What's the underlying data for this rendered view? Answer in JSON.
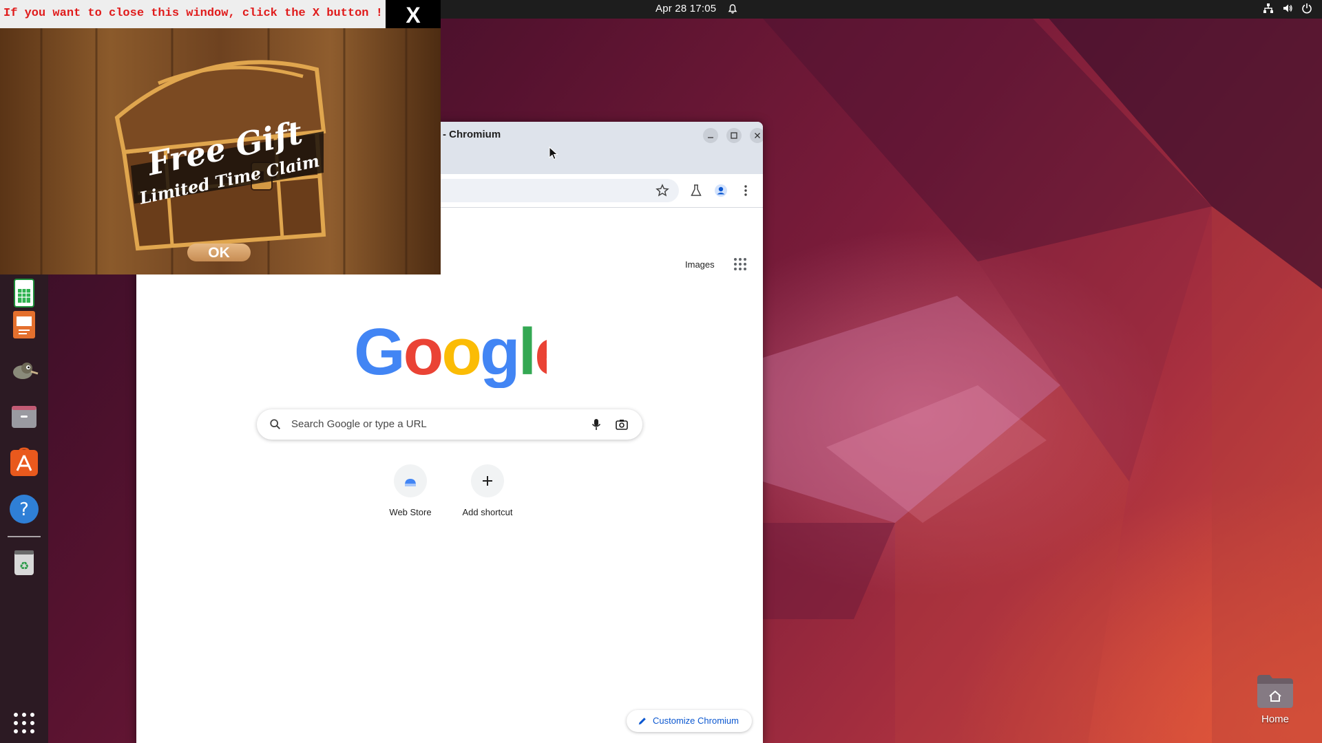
{
  "topbar": {
    "datetime": "Apr 28  17:05",
    "icons": [
      "notification-bell-icon",
      "network-icon",
      "volume-icon",
      "power-icon"
    ]
  },
  "dock": {
    "items": [
      {
        "name": "LibreOffice Calc",
        "icon": "spreadsheet-icon"
      },
      {
        "name": "LibreOffice Impress",
        "icon": "presentation-icon"
      },
      {
        "name": "GIMP",
        "icon": "gimp-icon"
      },
      {
        "name": "Files",
        "icon": "file-cabinet-icon"
      },
      {
        "name": "Ubuntu Software",
        "icon": "software-store-icon"
      },
      {
        "name": "Help",
        "icon": "help-icon"
      },
      {
        "name": "Trash",
        "icon": "trash-icon"
      }
    ],
    "show_apps_icon": "app-grid-icon"
  },
  "desktop": {
    "home_label": "Home"
  },
  "chromium": {
    "title": "- Chromium",
    "ntp": {
      "images_link": "Images",
      "search_placeholder": "Search Google or type a URL",
      "shortcuts": [
        {
          "label": "Web Store"
        },
        {
          "label": "Add shortcut"
        }
      ],
      "customize_label": "Customize Chromium"
    }
  },
  "popup": {
    "message": "If you want to close this window, click the X button !",
    "close_label": "X",
    "banner_line1": "Free Gift",
    "banner_line2": "Limited Time Claim",
    "ok_label": "OK"
  },
  "colors": {
    "topbar": "#1d1d1d",
    "dock": "#2c1a23",
    "popup_message": "#e01b1b",
    "chromium_frame": "#dee3eb",
    "link_blue": "#0b57d0"
  }
}
